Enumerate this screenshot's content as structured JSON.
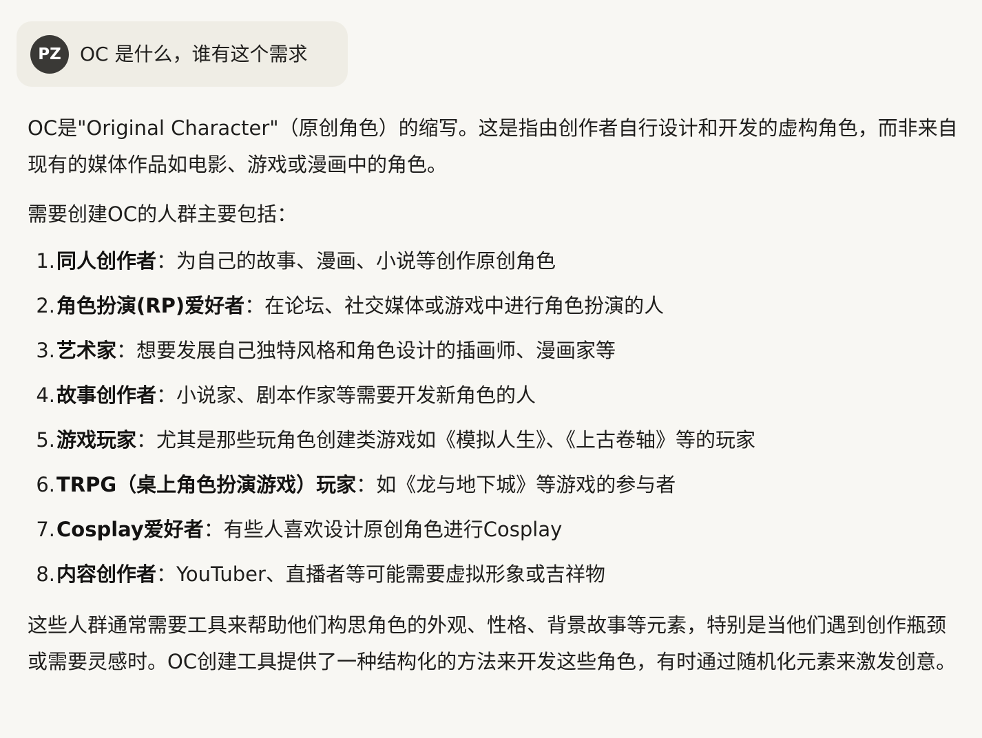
{
  "user_message": {
    "avatar_initials": "PZ",
    "text": "OC 是什么，谁有这个需求"
  },
  "response": {
    "paragraph1": "OC是\"Original Character\"（原创角色）的缩写。这是指由创作者自行设计和开发的虚构角色，而非来自现有的媒体作品如电影、游戏或漫画中的角色。",
    "paragraph2": "需要创建OC的人群主要包括：",
    "list": [
      {
        "number": "1.",
        "term": "同人创作者",
        "colon": "：",
        "desc": "为自己的故事、漫画、小说等创作原创角色"
      },
      {
        "number": "2.",
        "term": "角色扮演(RP)爱好者",
        "colon": "：",
        "desc": "在论坛、社交媒体或游戏中进行角色扮演的人"
      },
      {
        "number": "3.",
        "term": "艺术家",
        "colon": "：",
        "desc": "想要发展自己独特风格和角色设计的插画师、漫画家等"
      },
      {
        "number": "4.",
        "term": "故事创作者",
        "colon": "：",
        "desc": "小说家、剧本作家等需要开发新角色的人"
      },
      {
        "number": "5.",
        "term": "游戏玩家",
        "colon": "：",
        "desc": "尤其是那些玩角色创建类游戏如《模拟人生》、《上古卷轴》等的玩家"
      },
      {
        "number": "6.",
        "term": "TRPG（桌上角色扮演游戏）玩家",
        "colon": "：",
        "desc": "如《龙与地下城》等游戏的参与者"
      },
      {
        "number": "7.",
        "term": "Cosplay爱好者",
        "colon": "：",
        "desc": "有些人喜欢设计原创角色进行Cosplay"
      },
      {
        "number": "8.",
        "term": "内容创作者",
        "colon": "：",
        "desc": "YouTuber、直播者等可能需要虚拟形象或吉祥物"
      }
    ],
    "paragraph3": "这些人群通常需要工具来帮助他们构思角色的外观、性格、背景故事等元素，特别是当他们遇到创作瓶颈或需要灵感时。OC创建工具提供了一种结构化的方法来开发这些角色，有时通过随机化元素来激发创意。"
  }
}
